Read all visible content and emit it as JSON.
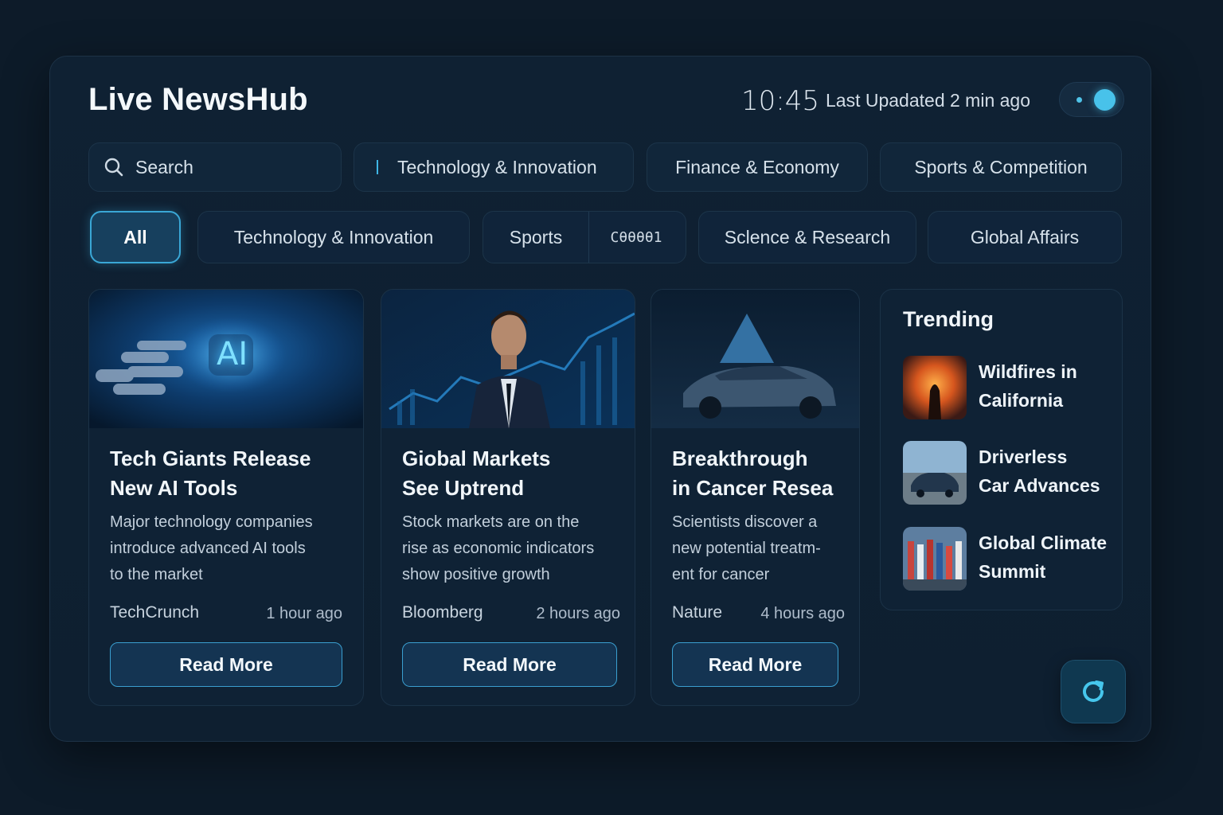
{
  "header": {
    "title": "Live NewsHub",
    "clock": "10:45",
    "last_updated": "Last Upadated 2 min ago"
  },
  "search": {
    "placeholder": "Search"
  },
  "top_categories": [
    {
      "label": "Technology & Innovation"
    },
    {
      "label": "Finance & Economy"
    },
    {
      "label": "Sports & Competition"
    }
  ],
  "filters": {
    "all": "All",
    "tech": "Technology & Innovation",
    "sports": "Sports",
    "sports_code": "Cθθθθ1",
    "science": "Sclence & Research",
    "global": "Global Affairs"
  },
  "articles": [
    {
      "title": "Tech Giants Release\nNew AI Tools",
      "summary": "Major technology companies\nintroduce advanced AI tools\nto the market",
      "source": "TechCrunch",
      "time": "1 hour ago",
      "button": "Read More",
      "image_overlay_text": "AI"
    },
    {
      "title": "Giobal Markets\nSee Uptrend",
      "summary": "Stock markets are on the\nrise as economic indicators\nshow positive growth",
      "source": "Bloomberg",
      "time": "2 hours ago",
      "button": "Read More"
    },
    {
      "title": "Breakthrough\nin Cancer Resea",
      "summary": "Scientists discover a\nnew potential treatm-\nent for cancer",
      "source": "Nature",
      "time": "4 hours ago",
      "button": "Read More"
    }
  ],
  "trending": {
    "heading": "Trending",
    "items": [
      {
        "label": "Wildfires in\nCalifornia"
      },
      {
        "label": "Driverless\nCar Advances"
      },
      {
        "label": "Global Climate\nSummit"
      }
    ]
  },
  "icons": {
    "search": "search-icon",
    "refresh": "refresh-icon",
    "toggle": "live-toggle"
  },
  "colors": {
    "background": "#0d1b29",
    "panel": "#0f2133",
    "accent": "#48c2ea",
    "button_border": "#3a9fd0"
  }
}
